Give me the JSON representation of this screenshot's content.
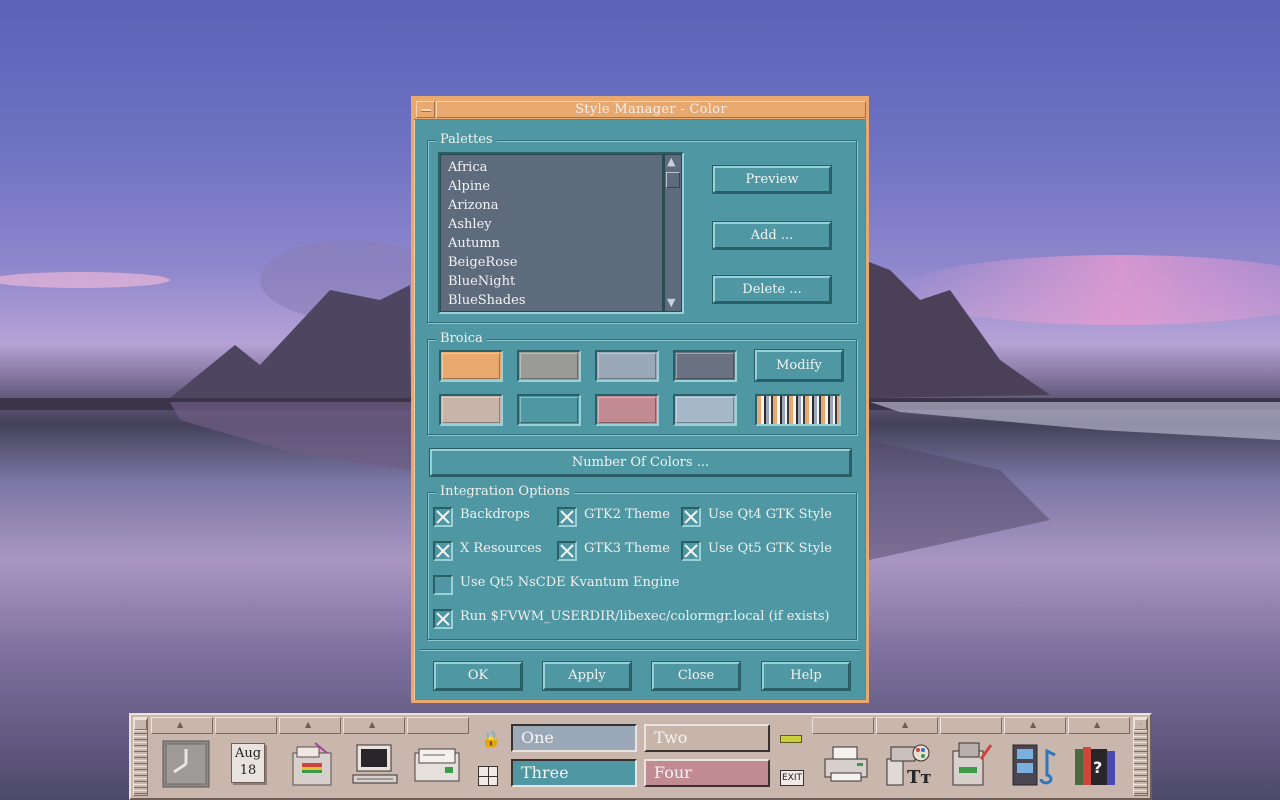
{
  "window": {
    "title": "Style Manager - Color"
  },
  "palettes": {
    "legend": "Palettes",
    "items": [
      "Africa",
      "Alpine",
      "Arizona",
      "Ashley",
      "Autumn",
      "BeigeRose",
      "BlueNight",
      "BlueShades"
    ],
    "buttons": {
      "preview": "Preview",
      "add": "Add ...",
      "delete": "Delete ..."
    }
  },
  "broica": {
    "legend": "Broica",
    "swatches": [
      "#e8a86e",
      "#9a9a96",
      "#9aa8b8",
      "#6b7282",
      "#c7b5aa",
      "#4f97a3",
      "#c28a92",
      "#a4b8c8"
    ],
    "modify": "Modify"
  },
  "number_of_colors": "Number Of Colors ...",
  "integration": {
    "legend": "Integration Options",
    "options": [
      {
        "label": "Backdrops",
        "checked": true
      },
      {
        "label": "GTK2 Theme",
        "checked": true
      },
      {
        "label": "Use Qt4 GTK Style",
        "checked": true
      },
      {
        "label": "X Resources",
        "checked": true
      },
      {
        "label": "GTK3 Theme",
        "checked": true
      },
      {
        "label": "Use Qt5 GTK Style",
        "checked": true
      },
      {
        "label": "Use Qt5 NsCDE Kvantum Engine",
        "checked": false
      },
      {
        "label": "Run $FVWM_USERDIR/libexec/colormgr.local (if exists)",
        "checked": true
      }
    ]
  },
  "dialog_buttons": {
    "ok": "OK",
    "apply": "Apply",
    "close": "Close",
    "help": "Help"
  },
  "panel": {
    "date": {
      "month": "Aug",
      "day": "18"
    },
    "workspaces": [
      {
        "label": "One",
        "color": "#9aa8b8"
      },
      {
        "label": "Two",
        "color": "#c7b5aa"
      },
      {
        "label": "Three",
        "color": "#4f97a3"
      },
      {
        "label": "Four",
        "color": "#c28a92"
      }
    ],
    "exit_label": "EXIT",
    "icons": [
      "clock-icon",
      "calendar-icon",
      "file-manager-icon",
      "terminal-icon",
      "mail-icon",
      "printer-icon",
      "style-manager-icon",
      "editor-icon",
      "media-player-icon",
      "help-books-icon"
    ]
  },
  "colors": {
    "window_bg": "#4f97a3",
    "title_bg": "#e8a86e",
    "panel_bg": "#c9b6ac",
    "list_bg": "#5e6b7c"
  }
}
